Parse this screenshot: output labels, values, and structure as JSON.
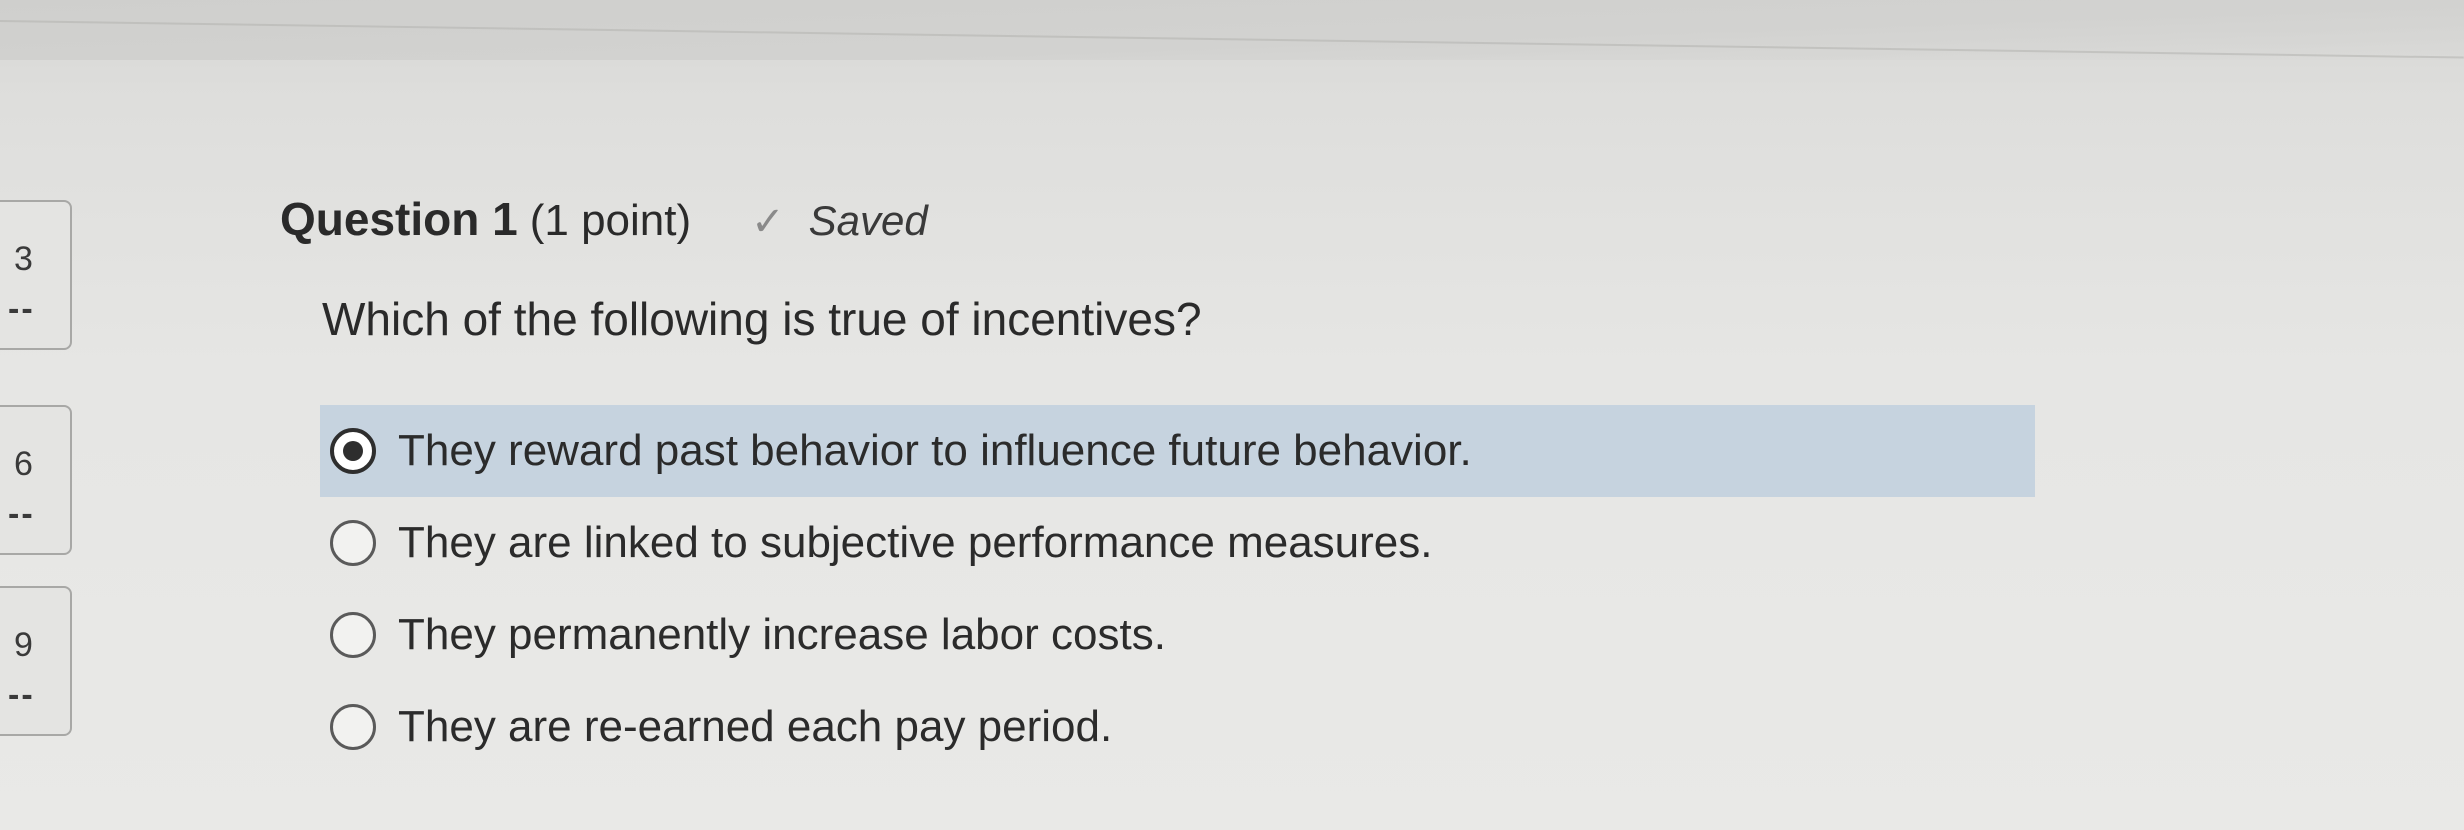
{
  "navigator": {
    "items": [
      {
        "number": "3",
        "status": "--"
      },
      {
        "number": "6",
        "status": "--"
      },
      {
        "number": "9",
        "status": "--"
      }
    ]
  },
  "question": {
    "title": "Question 1",
    "points": "(1 point)",
    "saved_icon": "check-icon",
    "saved_label": "Saved",
    "text": "Which of the following is true of incentives?"
  },
  "options": [
    {
      "label": "They reward past behavior to influence future behavior.",
      "selected": true
    },
    {
      "label": "They are linked to subjective performance measures.",
      "selected": false
    },
    {
      "label": "They permanently increase labor costs.",
      "selected": false
    },
    {
      "label": "They are re-earned each pay period.",
      "selected": false
    }
  ],
  "colors": {
    "selected_background": "#c6d3df",
    "page_background": "#e6e6e4"
  }
}
